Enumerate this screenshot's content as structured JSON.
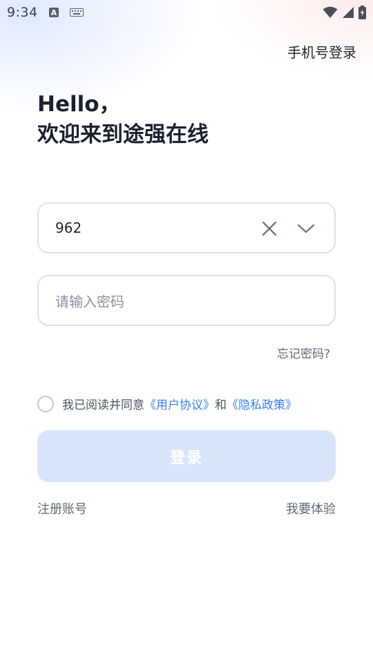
{
  "status_bar": {
    "time": "9:34",
    "input_indicator": "A"
  },
  "header": {
    "phone_login_label": "手机号登录"
  },
  "greeting": {
    "hello": "Hello，",
    "welcome": "欢迎来到途强在线"
  },
  "form": {
    "account_value": "962",
    "password_placeholder": "请输入密码",
    "forgot_password_label": "忘记密码?"
  },
  "agreement": {
    "prefix": "我已阅读并同意",
    "user_agreement": "《用户协议》",
    "conjunction": "和",
    "privacy_policy": "《隐私政策》",
    "checked": false
  },
  "actions": {
    "login_label": "登录",
    "register_label": "注册账号",
    "experience_label": "我要体验"
  },
  "colors": {
    "accent": "#3d7df3",
    "login_button_disabled": "#d8e5fb",
    "border": "#dde0e6"
  },
  "icons": {
    "clear": "close-icon",
    "dropdown": "chevron-down-icon",
    "wifi": "wifi-icon",
    "signal": "signal-icon",
    "battery": "battery-icon",
    "keyboard": "keyboard-icon"
  }
}
